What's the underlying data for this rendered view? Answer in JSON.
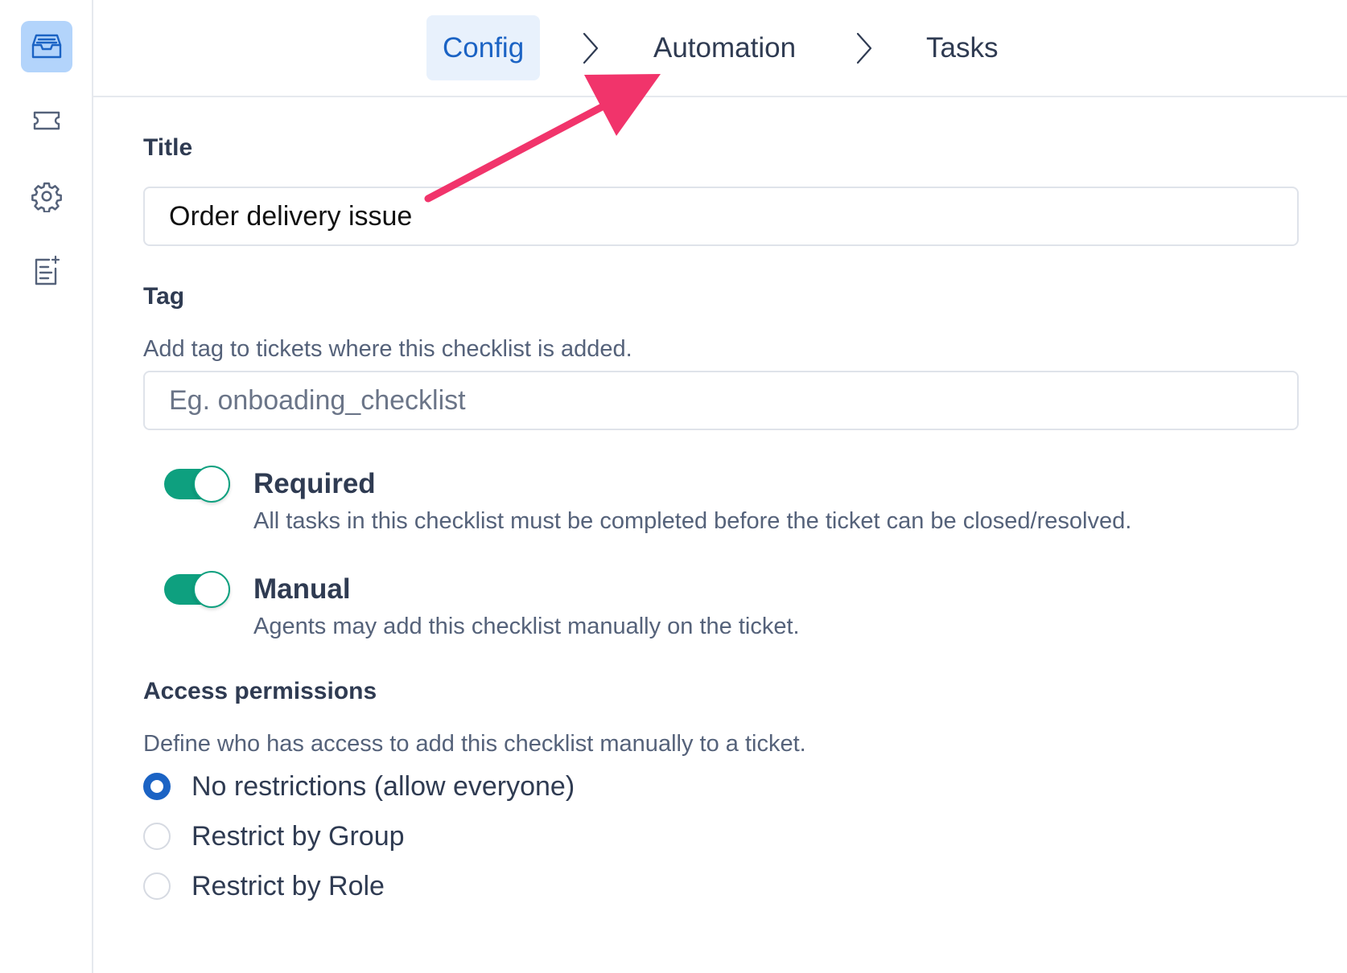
{
  "sidebar": {
    "items": [
      {
        "icon": "inbox-icon",
        "active": true
      },
      {
        "icon": "ticket-icon",
        "active": false
      },
      {
        "icon": "gear-icon",
        "active": false
      },
      {
        "icon": "document-sparkle-icon",
        "active": false
      }
    ]
  },
  "stepper": {
    "steps": [
      {
        "label": "Config",
        "active": true
      },
      {
        "label": "Automation",
        "active": false
      },
      {
        "label": "Tasks",
        "active": false
      }
    ],
    "separator_icon": "chevron-right-icon"
  },
  "form": {
    "title": {
      "label": "Title",
      "value": "Order delivery issue"
    },
    "tag": {
      "label": "Tag",
      "help": "Add tag to tickets where this checklist is added.",
      "placeholder": "Eg. onboading_checklist",
      "value": ""
    },
    "required": {
      "label": "Required",
      "description": "All tasks in this checklist must be completed before the ticket can be closed/resolved.",
      "enabled": true
    },
    "manual": {
      "label": "Manual",
      "description": "Agents may add this checklist manually on the ticket.",
      "enabled": true
    },
    "access": {
      "label": "Access permissions",
      "help": "Define who has access to add this checklist manually to a ticket.",
      "options": [
        {
          "label": "No restrictions (allow everyone)",
          "checked": true
        },
        {
          "label": "Restrict by Group",
          "checked": false
        },
        {
          "label": "Restrict by Role",
          "checked": false
        }
      ]
    }
  },
  "colors": {
    "accent": "#1b63c4",
    "toggle_on": "#0ea07f",
    "annotation_arrow": "#f1346b"
  }
}
